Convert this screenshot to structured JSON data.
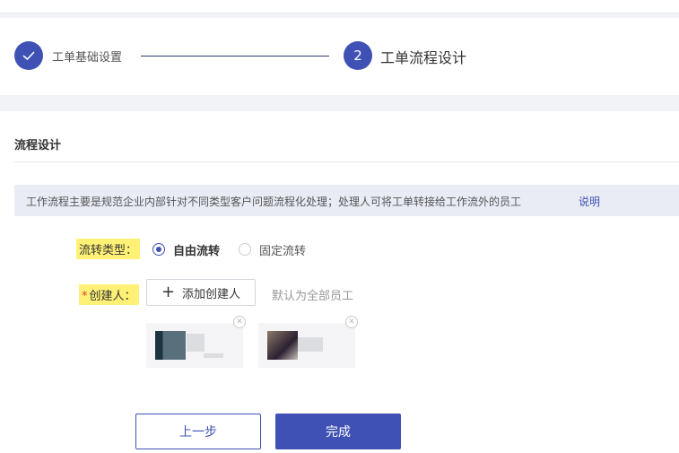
{
  "steps": {
    "step1": {
      "label": "工单基础设置",
      "status": "done"
    },
    "step2": {
      "number": "2",
      "label": "工单流程设计",
      "status": "active"
    }
  },
  "section": {
    "title": "流程设计"
  },
  "info": {
    "text": "工作流程主要是规范企业内部针对不同类型客户问题流程化处理；处理人可将工单转接给工作流外的员工",
    "link": "说明"
  },
  "form": {
    "flow_type": {
      "label": "流转类型：",
      "options": [
        {
          "label": "自由流转",
          "selected": true
        },
        {
          "label": "固定流转",
          "selected": false
        }
      ]
    },
    "creator": {
      "required_mark": "*",
      "label": "创建人：",
      "add_button": "添加创建人",
      "default_hint": "默认为全部员工"
    }
  },
  "buttons": {
    "prev": "上一步",
    "done": "完成"
  },
  "colors": {
    "primary": "#3f51b5",
    "highlight": "#fff176",
    "required": "#e53935"
  }
}
